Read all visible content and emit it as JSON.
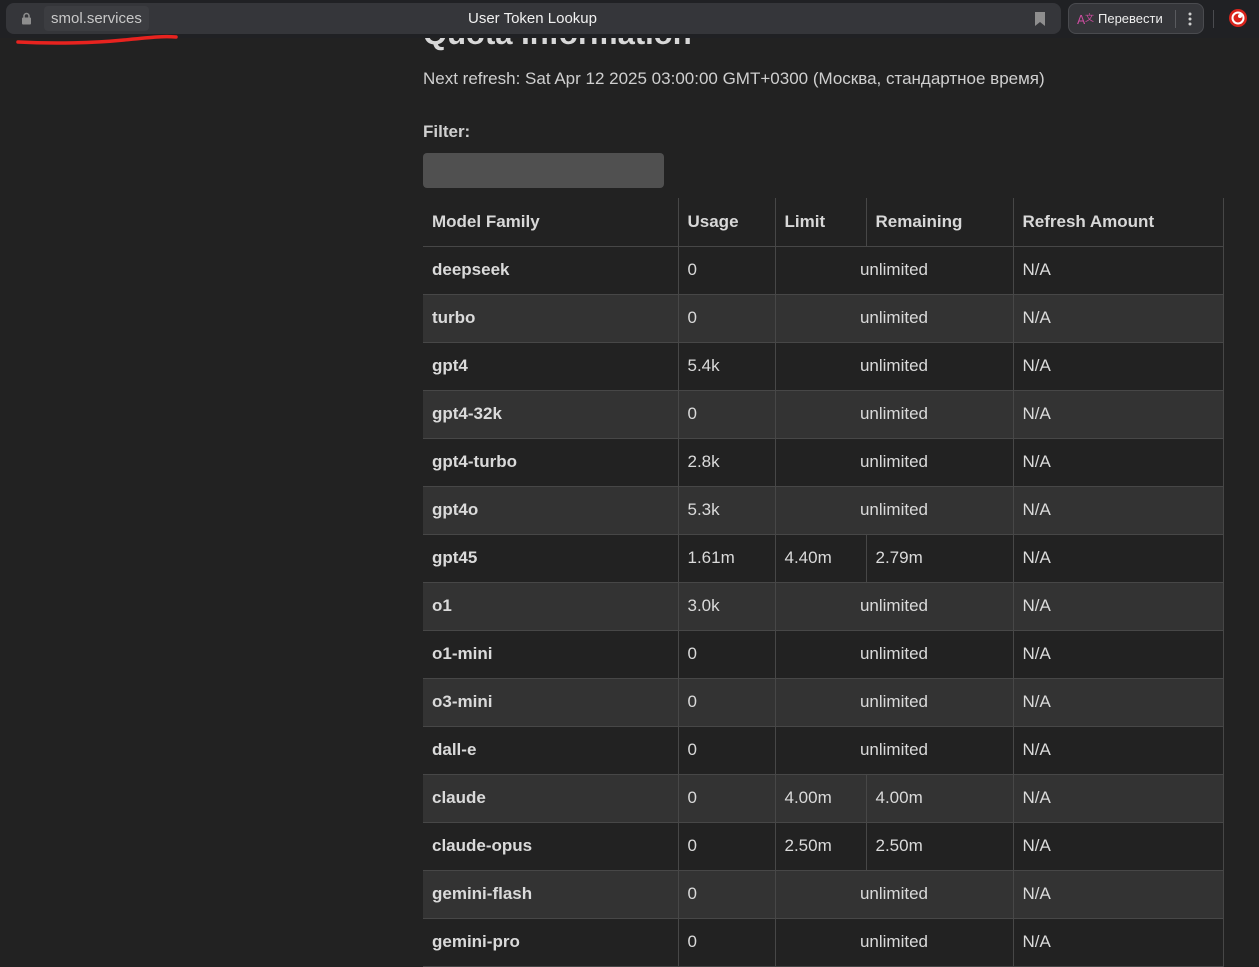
{
  "browser": {
    "url": "smol.services",
    "title": "User Token Lookup",
    "translate_label": "Перевести"
  },
  "page": {
    "section_title": "Quota Information",
    "next_refresh": "Next refresh: Sat Apr 12 2025 03:00:00 GMT+0300 (Москва, стандартное время)",
    "filter_label": "Filter:",
    "filter_value": ""
  },
  "table": {
    "headers": {
      "model": "Model Family",
      "usage": "Usage",
      "limit": "Limit",
      "remaining": "Remaining",
      "refresh": "Refresh Amount"
    },
    "rows": [
      {
        "model": "deepseek",
        "usage": "0",
        "limit": "unlimited",
        "remaining": null,
        "refresh": "N/A"
      },
      {
        "model": "turbo",
        "usage": "0",
        "limit": "unlimited",
        "remaining": null,
        "refresh": "N/A"
      },
      {
        "model": "gpt4",
        "usage": "5.4k",
        "limit": "unlimited",
        "remaining": null,
        "refresh": "N/A"
      },
      {
        "model": "gpt4-32k",
        "usage": "0",
        "limit": "unlimited",
        "remaining": null,
        "refresh": "N/A"
      },
      {
        "model": "gpt4-turbo",
        "usage": "2.8k",
        "limit": "unlimited",
        "remaining": null,
        "refresh": "N/A"
      },
      {
        "model": "gpt4o",
        "usage": "5.3k",
        "limit": "unlimited",
        "remaining": null,
        "refresh": "N/A"
      },
      {
        "model": "gpt45",
        "usage": "1.61m",
        "limit": "4.40m",
        "remaining": "2.79m",
        "refresh": "N/A"
      },
      {
        "model": "o1",
        "usage": "3.0k",
        "limit": "unlimited",
        "remaining": null,
        "refresh": "N/A"
      },
      {
        "model": "o1-mini",
        "usage": "0",
        "limit": "unlimited",
        "remaining": null,
        "refresh": "N/A"
      },
      {
        "model": "o3-mini",
        "usage": "0",
        "limit": "unlimited",
        "remaining": null,
        "refresh": "N/A"
      },
      {
        "model": "dall-e",
        "usage": "0",
        "limit": "unlimited",
        "remaining": null,
        "refresh": "N/A"
      },
      {
        "model": "claude",
        "usage": "0",
        "limit": "4.00m",
        "remaining": "4.00m",
        "refresh": "N/A"
      },
      {
        "model": "claude-opus",
        "usage": "0",
        "limit": "2.50m",
        "remaining": "2.50m",
        "refresh": "N/A"
      },
      {
        "model": "gemini-flash",
        "usage": "0",
        "limit": "unlimited",
        "remaining": null,
        "refresh": "N/A"
      },
      {
        "model": "gemini-pro",
        "usage": "0",
        "limit": "unlimited",
        "remaining": null,
        "refresh": "N/A"
      }
    ]
  },
  "icons": {
    "lock": "lock-icon",
    "bookmark": "bookmark-icon",
    "translate": "translate-icon",
    "menu": "kebab-menu-icon",
    "extension": "extension-icon"
  },
  "colors": {
    "background": "#222222",
    "row_alt": "#333333",
    "annotation_red": "#e8231f",
    "extension_red": "#d9241c"
  }
}
